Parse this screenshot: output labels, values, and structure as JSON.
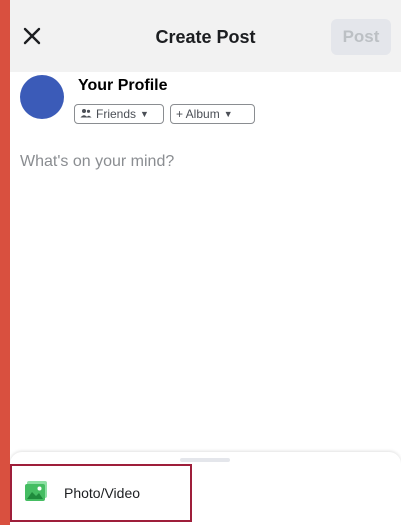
{
  "header": {
    "title": "Create Post",
    "post_label": "Post"
  },
  "profile": {
    "name": "Your Profile"
  },
  "audience": {
    "friends_label": "Friends",
    "album_label": "+ Album"
  },
  "composer": {
    "placeholder": "What's on your mind?"
  },
  "actions": [
    {
      "label": "Photo/Video",
      "icon": "photo-icon"
    }
  ],
  "colors": {
    "outer_frame": "#d9503f",
    "header_bg": "#f2f2f2",
    "avatar": "#3b5bb8",
    "photo_icon": "#45bd62",
    "highlight_border": "#9e1e3a"
  }
}
